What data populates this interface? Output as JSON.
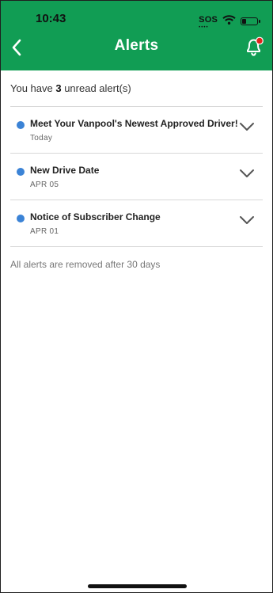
{
  "status_bar": {
    "time": "10:43",
    "sos": "SOS",
    "sos_dots": "••••",
    "wifi_icon": "wifi-icon",
    "battery_icon": "battery-low-icon"
  },
  "header": {
    "title": "Alerts",
    "back_icon": "chevron-left-icon",
    "bell_icon": "bell-with-badge-icon",
    "background": "#119d54",
    "badge_color": "#e0241b"
  },
  "summary": {
    "prefix": "You have ",
    "count": "3",
    "suffix": " unread alert(s)"
  },
  "alerts": [
    {
      "title": "Meet Your Vanpool's Newest Approved Driver!",
      "date": "Today",
      "unread": true
    },
    {
      "title": "New Drive Date",
      "date": "APR 05",
      "unread": true
    },
    {
      "title": "Notice of Subscriber Change",
      "date": "APR 01",
      "unread": true
    }
  ],
  "footer_note": "All alerts are removed after 30 days",
  "colors": {
    "unread_dot": "#3b83d6",
    "divider": "#d8d8d8"
  }
}
